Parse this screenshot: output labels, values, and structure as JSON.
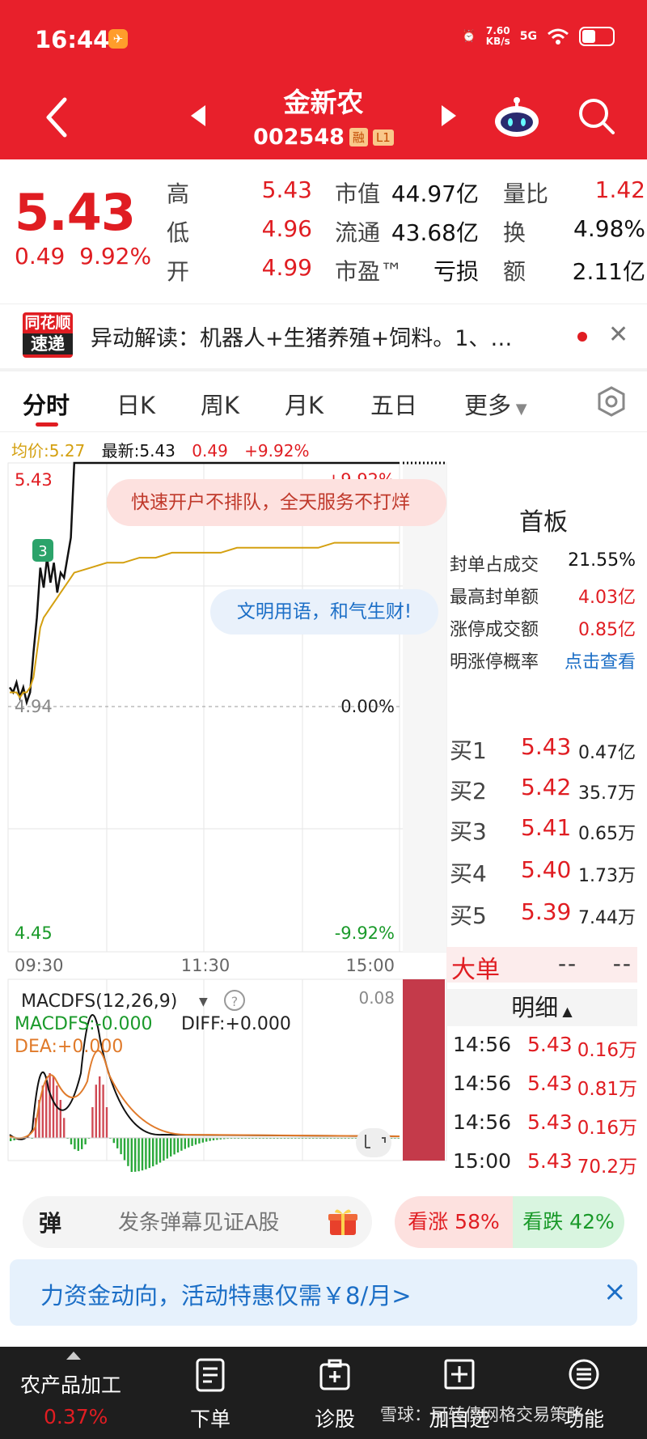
{
  "status": {
    "time": "16:44",
    "net_speed_top": "7.60",
    "net_speed_bottom": "KB/s",
    "signal": "5G"
  },
  "header": {
    "name": "金新农",
    "code": "002548",
    "tag_margin": "融",
    "tag_level": "L1"
  },
  "quote": {
    "price": "5.43",
    "change": "0.49",
    "change_pct": "9.92%",
    "high_label": "高",
    "high": "5.43",
    "low_label": "低",
    "low": "4.96",
    "open_label": "开",
    "open": "4.99",
    "mcap_label": "市值",
    "mcap": "44.97亿",
    "float_label": "流通",
    "float": "43.68亿",
    "pe_label": "市盈™",
    "pe": "亏损",
    "vr_label": "量比",
    "vr": "1.42",
    "turnover_label": "换",
    "turnover": "4.98%",
    "amount_label": "额",
    "amount": "2.11亿"
  },
  "news": {
    "logo_top": "同花顺",
    "logo_bottom": "速递",
    "text": "异动解读：机器人+生猪养殖+饲料。1、…"
  },
  "tabs": [
    "分时",
    "日K",
    "周K",
    "月K",
    "五日",
    "更多"
  ],
  "intraday": {
    "avg": "均价:5.27",
    "last": "最新:5.43",
    "chg": "0.49",
    "pct": "+9.92%"
  },
  "chart_labels": {
    "top_price": "5.43",
    "top_pct": "+9.92%",
    "mid_price": "4.94",
    "mid_pct": "0.00%",
    "bot_price": "4.45",
    "bot_pct": "-9.92%",
    "t_open": "09:30",
    "t_mid": "11:30",
    "t_close": "15:00",
    "marker": "3"
  },
  "macd": {
    "title": "MACDFS(12,26,9)",
    "help": "?",
    "macdfs": "MACDFS:-0.000",
    "diff": "DIFF:+0.000",
    "dea": "DEA:+0.000",
    "scale": "0.08"
  },
  "overlays": {
    "promo": "快速开户不排队，全天服务不打烊",
    "civil": "文明用语，和气生财!"
  },
  "limit_panel": {
    "title": "首板",
    "rows": [
      {
        "label": "封单占成交",
        "value": "21.55%"
      },
      {
        "label": "最高封单额",
        "value": "4.03亿"
      },
      {
        "label": "涨停成交额",
        "value": "0.85亿"
      },
      {
        "label": "明涨停概率",
        "value": "点击查看"
      }
    ]
  },
  "orderbook": [
    {
      "label": "买1",
      "price": "5.43",
      "vol": "0.47亿"
    },
    {
      "label": "买2",
      "price": "5.42",
      "vol": "35.7万"
    },
    {
      "label": "买3",
      "price": "5.41",
      "vol": "0.65万"
    },
    {
      "label": "买4",
      "price": "5.40",
      "vol": "1.73万"
    },
    {
      "label": "买5",
      "price": "5.39",
      "vol": "7.44万"
    }
  ],
  "big_order": {
    "label": "大单",
    "v1": "--",
    "v2": "--"
  },
  "detail": {
    "label": "明细",
    "ticks": [
      {
        "time": "14:56",
        "price": "5.43",
        "vol": "0.16万"
      },
      {
        "time": "14:56",
        "price": "5.43",
        "vol": "0.81万"
      },
      {
        "time": "14:56",
        "price": "5.43",
        "vol": "0.16万"
      },
      {
        "time": "15:00",
        "price": "5.43",
        "vol": "70.2万"
      }
    ]
  },
  "actions": {
    "danmu_icon": "弹",
    "danmu_placeholder": "发条弹幕见证A股",
    "vote_up": "看涨 58%",
    "vote_down": "看跌 42%"
  },
  "banner": {
    "text": "力资金动向，活动特惠仅需￥8/月>",
    "close": "×"
  },
  "nav": {
    "sector_name": "农产品加工",
    "sector_chg": "0.37%",
    "order": "下单",
    "diagnose": "诊股",
    "watchlist": "加自选",
    "function": "功能",
    "watermark": "雪球：可转债网格交易策略"
  },
  "colors": {
    "up": "#e01d22",
    "down": "#1a9a2a",
    "brand": "#e8202b",
    "avg_line": "#d4a010",
    "price_line": "#111111"
  },
  "chart_data": {
    "type": "line",
    "title": "",
    "prev_close": 4.94,
    "ylim": [
      4.45,
      5.43
    ],
    "y_ticks": [
      "5.43",
      "4.94",
      "4.45"
    ],
    "x_ticks": [
      "09:30",
      "11:30",
      "15:00"
    ],
    "series": [
      {
        "name": "最新",
        "values": [
          4.98,
          4.97,
          4.99,
          4.96,
          4.98,
          4.95,
          4.97,
          5.05,
          5.12,
          5.22,
          5.18,
          5.24,
          5.19,
          5.23,
          5.17,
          5.21,
          5.2,
          5.24,
          5.28,
          5.43,
          5.43,
          5.43,
          5.43,
          5.43,
          5.43,
          5.43,
          5.43,
          5.43,
          5.43,
          5.43,
          5.43,
          5.43,
          5.43,
          5.43,
          5.43,
          5.43,
          5.43,
          5.43,
          5.43,
          5.43
        ]
      },
      {
        "name": "均价",
        "values": [
          4.97,
          4.97,
          4.97,
          4.96,
          4.97,
          4.97,
          4.98,
          5.0,
          5.05,
          5.1,
          5.12,
          5.13,
          5.14,
          5.15,
          5.16,
          5.17,
          5.18,
          5.19,
          5.2,
          5.21,
          5.22,
          5.23,
          5.23,
          5.24,
          5.24,
          5.25,
          5.25,
          5.25,
          5.25,
          5.26,
          5.26,
          5.26,
          5.26,
          5.26,
          5.26,
          5.27,
          5.27,
          5.27,
          5.27,
          5.27
        ]
      }
    ]
  }
}
